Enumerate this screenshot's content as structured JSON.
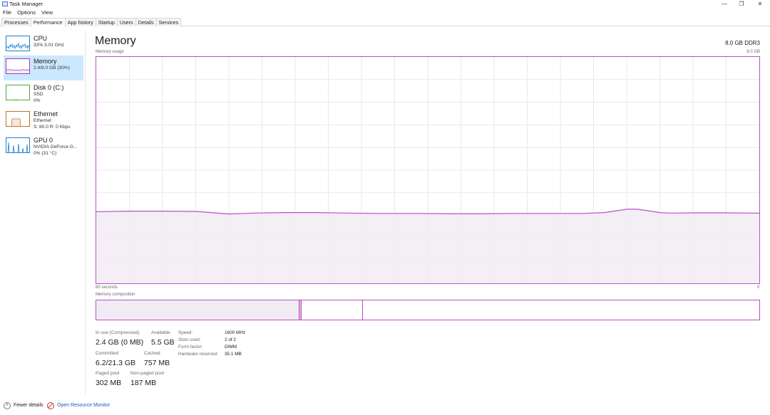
{
  "window": {
    "title": "Task Manager",
    "icon": "task-manager-icon"
  },
  "window_controls": {
    "minimize": "—",
    "restore": "❐",
    "close": "✕"
  },
  "menu": [
    "File",
    "Options",
    "View"
  ],
  "tabs": [
    {
      "label": "Processes",
      "active": false
    },
    {
      "label": "Performance",
      "active": true
    },
    {
      "label": "App history",
      "active": false
    },
    {
      "label": "Startup",
      "active": false
    },
    {
      "label": "Users",
      "active": false
    },
    {
      "label": "Details",
      "active": false
    },
    {
      "label": "Services",
      "active": false
    }
  ],
  "sidebar": [
    {
      "name": "CPU",
      "lines": [
        "33% 3.01 GHz"
      ],
      "color": "#1f7fd1",
      "active": false
    },
    {
      "name": "Memory",
      "lines": [
        "2.4/8.0 GB (30%)"
      ],
      "color": "#9b3fb0",
      "active": true
    },
    {
      "name": "Disk 0 (C:)",
      "lines": [
        "SSD",
        "0%"
      ],
      "color": "#4ca83a",
      "active": false
    },
    {
      "name": "Ethernet",
      "lines": [
        "Ethernet",
        "S: 80.0  R: 0 Kbps"
      ],
      "color": "#c0732a",
      "active": false
    },
    {
      "name": "GPU 0",
      "lines": [
        "NVIDIA GeForce G...",
        "0% (31 °C)"
      ],
      "color": "#1f7fd1",
      "active": false
    }
  ],
  "main": {
    "title": "Memory",
    "subtitle": "8.0 GB DDR3",
    "graph_label": "Memory usage",
    "graph_max": "8.0 GB",
    "time_left": "60 seconds",
    "time_right": "0",
    "composition_label": "Memory composition"
  },
  "chart_data": {
    "type": "area",
    "title": "Memory usage",
    "xlabel": "60 seconds",
    "ylabel": "",
    "xlim": [
      60,
      0
    ],
    "ylim": [
      0,
      8.0
    ],
    "grid": true,
    "color": "#b94fc6",
    "fill": "#f1ecf3",
    "x": [
      60,
      57,
      54,
      51,
      48,
      46,
      43,
      40,
      37,
      34,
      31,
      28,
      25,
      22,
      19,
      16,
      14,
      12,
      11,
      9,
      8,
      6,
      3,
      0
    ],
    "values": [
      2.53,
      2.55,
      2.55,
      2.54,
      2.45,
      2.48,
      2.5,
      2.5,
      2.48,
      2.47,
      2.47,
      2.46,
      2.46,
      2.47,
      2.47,
      2.47,
      2.5,
      2.62,
      2.62,
      2.5,
      2.48,
      2.49,
      2.49,
      2.48
    ]
  },
  "composition": [
    {
      "fraction": 0.306,
      "fill": "#f1ecf3",
      "edge": "#b94fc6"
    },
    {
      "fraction": 0.004,
      "fill": "#d9b8df",
      "edge": "#b94fc6"
    },
    {
      "fraction": 0.092,
      "fill": "#ffffff",
      "edge": "#b94fc6"
    },
    {
      "fraction": 0.598,
      "fill": "#ffffff",
      "edge": "#b94fc6"
    }
  ],
  "stats": {
    "in_use_label": "In use (Compressed)",
    "in_use": "2.4 GB (0 MB)",
    "available_label": "Available",
    "available": "5.5 GB",
    "committed_label": "Committed",
    "committed": "6.2/21.3 GB",
    "cached_label": "Cached",
    "cached": "757 MB",
    "paged_label": "Paged pool",
    "paged": "302 MB",
    "nonpaged_label": "Non-paged pool",
    "nonpaged": "187 MB"
  },
  "specs": [
    {
      "label": "Speed:",
      "value": "1600 MHz"
    },
    {
      "label": "Slots used:",
      "value": "2 of 2"
    },
    {
      "label": "Form factor:",
      "value": "DIMM"
    },
    {
      "label": "Hardware reserved:",
      "value": "35.1 MB"
    }
  ],
  "footer": {
    "fewer_details": "Fewer details",
    "resource_monitor": "Open Resource Monitor"
  }
}
